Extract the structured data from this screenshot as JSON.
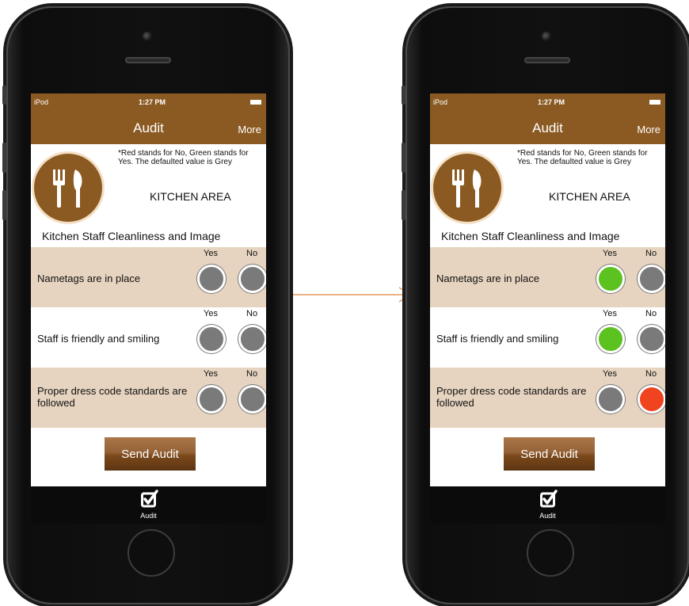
{
  "status": {
    "carrier": "iPod",
    "time": "1:27 PM"
  },
  "nav": {
    "title": "Audit",
    "more": "More"
  },
  "header": {
    "note": "*Red stands for No, Green stands for Yes. The defaulted value is Grey",
    "area": "KITCHEN AREA",
    "section": "Kitchen Staff Cleanliness and Image"
  },
  "labels": {
    "yes": "Yes",
    "no": "No"
  },
  "items": [
    {
      "label": "Nametags are in place"
    },
    {
      "label": "Staff is friendly and smiling"
    },
    {
      "label": "Proper dress code standards are followed"
    }
  ],
  "send_label": "Send Audit",
  "tab": {
    "label": "Audit",
    "icon": "checkbox-icon"
  },
  "states": {
    "before": [
      "grey/grey",
      "grey/grey",
      "grey/grey"
    ],
    "after": [
      "green/grey",
      "green/grey",
      "grey/red"
    ]
  },
  "colors": {
    "brown": "#8b5a22",
    "tan": "#e6d4c0",
    "grey": "#7a7a7a",
    "green": "#5cc21f",
    "red": "#f0431f",
    "arrow": "#e0883a"
  }
}
